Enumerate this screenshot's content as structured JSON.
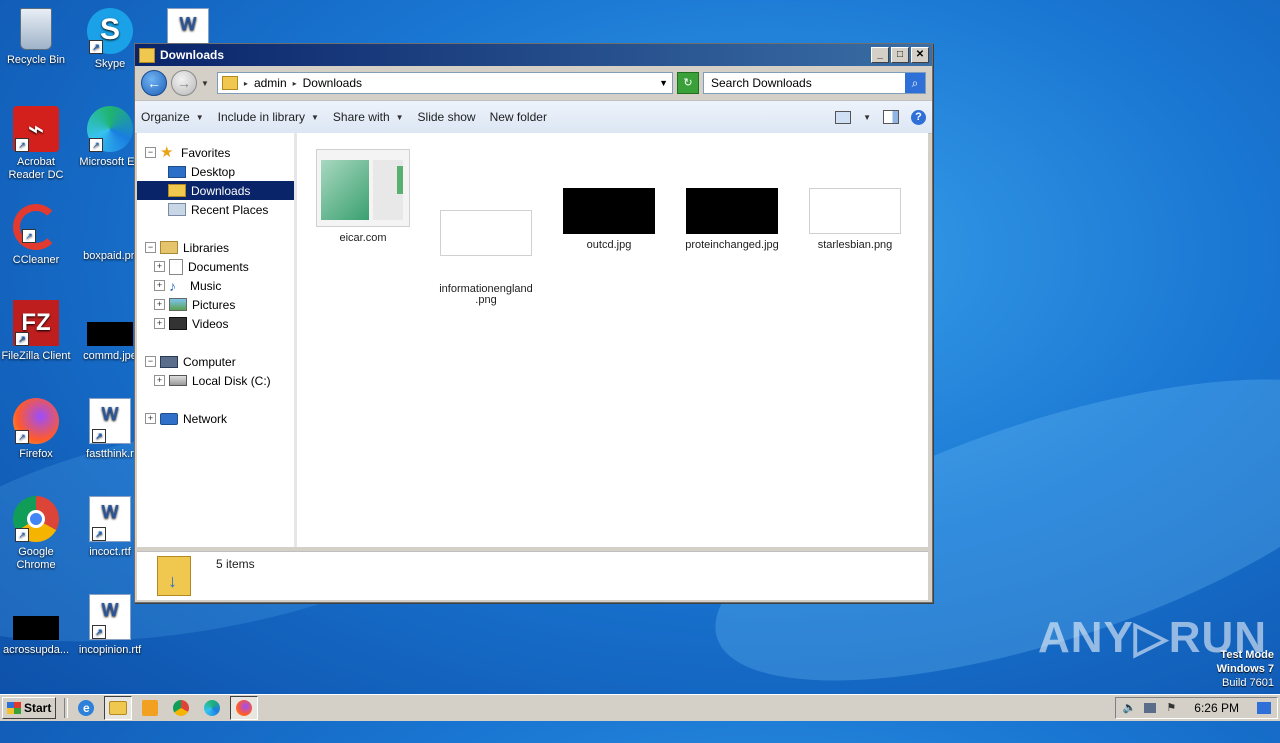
{
  "desktop": {
    "icons": [
      {
        "label": "Recycle Bin"
      },
      {
        "label": "Skype"
      },
      {
        "label": "Acrobat\nReader DC"
      },
      {
        "label": "Microsoft Ed"
      },
      {
        "label": "CCleaner"
      },
      {
        "label": "boxpaid.pn"
      },
      {
        "label": "FileZilla Client"
      },
      {
        "label": "commd.jpe"
      },
      {
        "label": "Firefox"
      },
      {
        "label": "fastthink.r"
      },
      {
        "label": "Google\nChrome"
      },
      {
        "label": "incoct.rtf"
      },
      {
        "label": "acrossupda..."
      },
      {
        "label": "incopinion.rtf"
      }
    ],
    "watermark": "ANY▷RUN",
    "os_info": {
      "line1": "Test Mode",
      "line2": "Windows 7",
      "line3": "Build 7601"
    }
  },
  "window": {
    "title": "Downloads",
    "buttons": {
      "minimize": "_",
      "maximize": "□",
      "close": "✕"
    },
    "address": {
      "crumbs": [
        "admin",
        "Downloads"
      ]
    },
    "search": {
      "placeholder": "Search Downloads"
    },
    "toolbar": {
      "organize": "Organize",
      "include": "Include in library",
      "share": "Share with",
      "slideshow": "Slide show",
      "newfolder": "New folder"
    },
    "nav": {
      "favorites": "Favorites",
      "desktop": "Desktop",
      "downloads": "Downloads",
      "recent": "Recent Places",
      "libraries": "Libraries",
      "documents": "Documents",
      "music": "Music",
      "pictures": "Pictures",
      "videos": "Videos",
      "computer": "Computer",
      "localdisk": "Local Disk (C:)",
      "network": "Network"
    },
    "files": [
      {
        "name": "eicar.com"
      },
      {
        "name": "informationengland\n.png"
      },
      {
        "name": "outcd.jpg"
      },
      {
        "name": "proteinchanged.jpg"
      },
      {
        "name": "starlesbian.png"
      }
    ],
    "status": {
      "count": "5 items"
    }
  },
  "taskbar": {
    "start": "Start",
    "clock": "6:26 PM"
  }
}
